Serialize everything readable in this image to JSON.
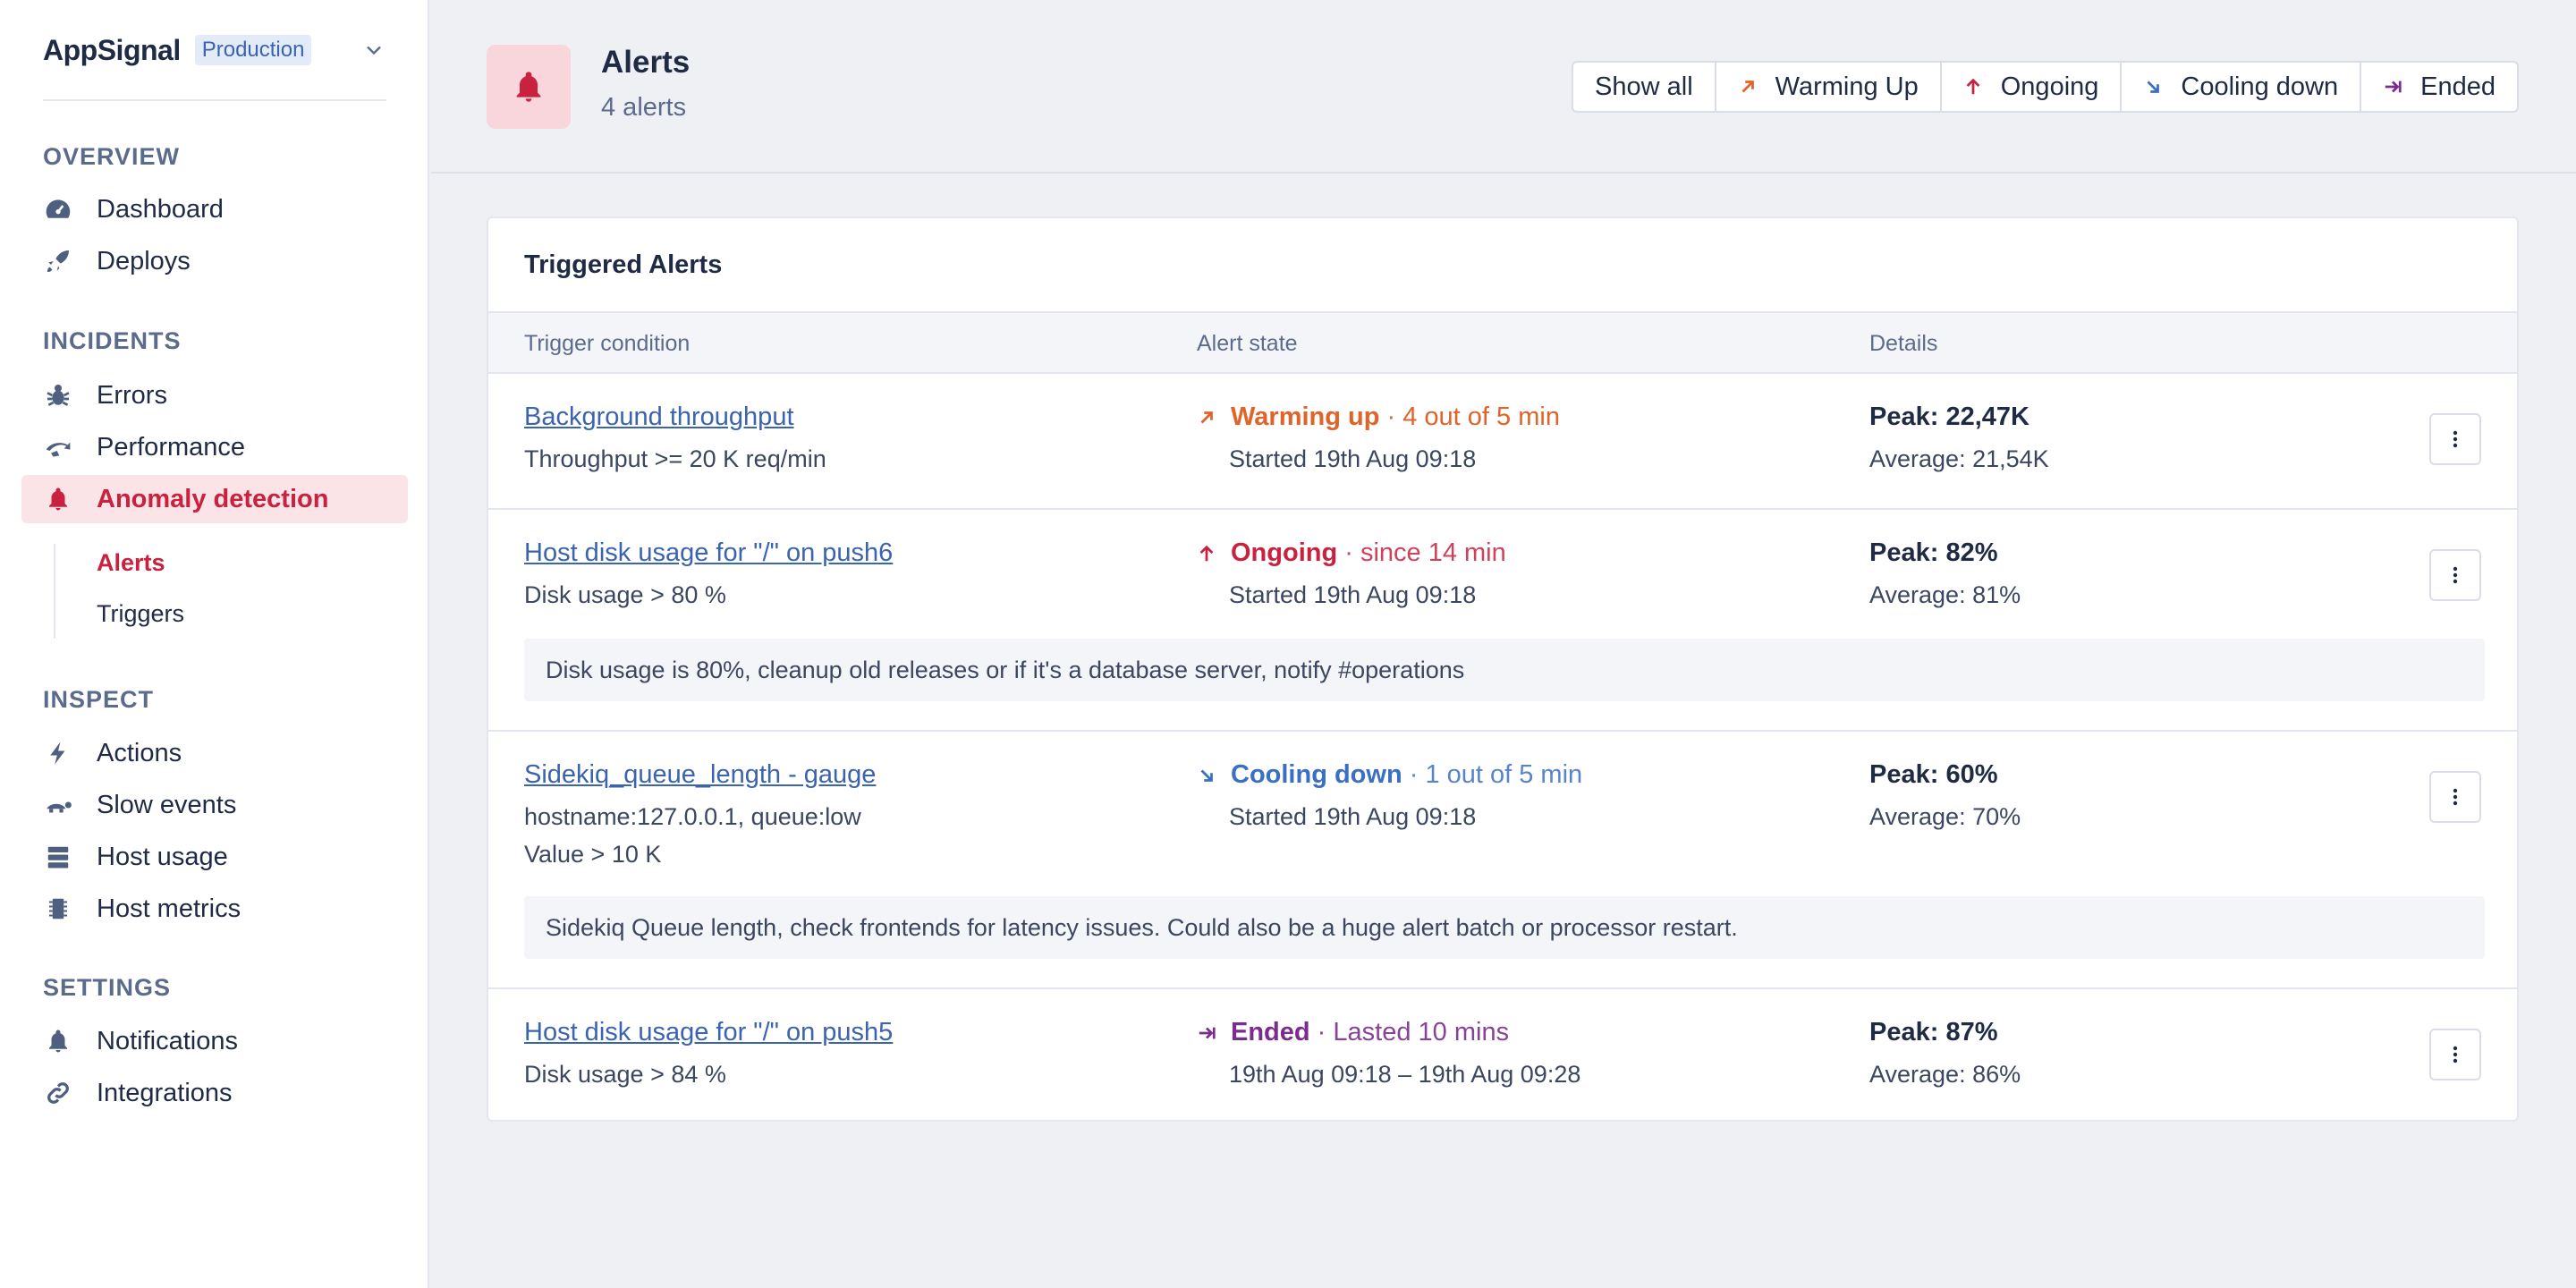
{
  "brand": {
    "name": "AppSignal",
    "environment": "Production"
  },
  "sidebar": {
    "sections": [
      {
        "title": "OVERVIEW",
        "items": [
          {
            "label": "Dashboard",
            "icon": "dashboard-icon"
          },
          {
            "label": "Deploys",
            "icon": "rocket-icon"
          }
        ]
      },
      {
        "title": "INCIDENTS",
        "items": [
          {
            "label": "Errors",
            "icon": "bug-icon"
          },
          {
            "label": "Performance",
            "icon": "performance-icon"
          },
          {
            "label": "Anomaly detection",
            "icon": "bell-icon",
            "active": true
          }
        ],
        "subitems": [
          {
            "label": "Alerts",
            "active": true
          },
          {
            "label": "Triggers"
          }
        ]
      },
      {
        "title": "INSPECT",
        "items": [
          {
            "label": "Actions",
            "icon": "bolt-icon"
          },
          {
            "label": "Slow events",
            "icon": "turtle-icon"
          },
          {
            "label": "Host usage",
            "icon": "server-icon"
          },
          {
            "label": "Host metrics",
            "icon": "chip-icon"
          }
        ]
      },
      {
        "title": "SETTINGS",
        "items": [
          {
            "label": "Notifications",
            "icon": "bell-icon"
          },
          {
            "label": "Integrations",
            "icon": "link-icon"
          }
        ]
      }
    ]
  },
  "header": {
    "title": "Alerts",
    "subtitle": "4 alerts",
    "filters": [
      "Show all",
      "Warming Up",
      "Ongoing",
      "Cooling down",
      "Ended"
    ]
  },
  "card": {
    "title": "Triggered Alerts",
    "columns": [
      "Trigger condition",
      "Alert state",
      "Details"
    ],
    "rows": [
      {
        "condition": "Background throughput",
        "condition_detail": [
          "Throughput >= 20 K req/min"
        ],
        "state": "Warming up",
        "state_extra": " · 4 out of 5 min",
        "state_color": "#e0632a",
        "started": "Started 19th Aug 09:18",
        "peak": "Peak: 22,47K",
        "average": "Average: 21,54K"
      },
      {
        "condition": "Host disk usage for \"/\" on push6",
        "condition_detail": [
          "Disk usage > 80 %"
        ],
        "state": "Ongoing",
        "state_extra": " · since 14 min",
        "state_color": "#c8223f",
        "started": "Started 19th Aug 09:18",
        "peak": "Peak: 82%",
        "average": "Average: 81%",
        "note": "Disk usage is 80%, cleanup old releases or if it's a database server, notify #operations"
      },
      {
        "condition": "Sidekiq_queue_length - gauge",
        "condition_detail": [
          "hostname:127.0.0.1, queue:low",
          "Value > 10 K"
        ],
        "state": "Cooling down",
        "state_extra": " · 1 out of 5 min",
        "state_color": "#3a6fc4",
        "started": "Started 19th Aug 09:18",
        "peak": "Peak: 60%",
        "average": "Average: 70%",
        "note": "Sidekiq Queue length, check frontends for latency issues. Could also be a huge alert batch or processor restart."
      },
      {
        "condition": "Host disk usage for \"/\" on push5",
        "condition_detail": [
          "Disk usage > 84 %"
        ],
        "state": "Ended",
        "state_extra": " · Lasted 10 mins",
        "state_color": "#7b2d8e",
        "started": "19th Aug 09:18 – 19th Aug 09:28",
        "peak": "Peak: 87%",
        "average": "Average: 86%"
      }
    ]
  }
}
